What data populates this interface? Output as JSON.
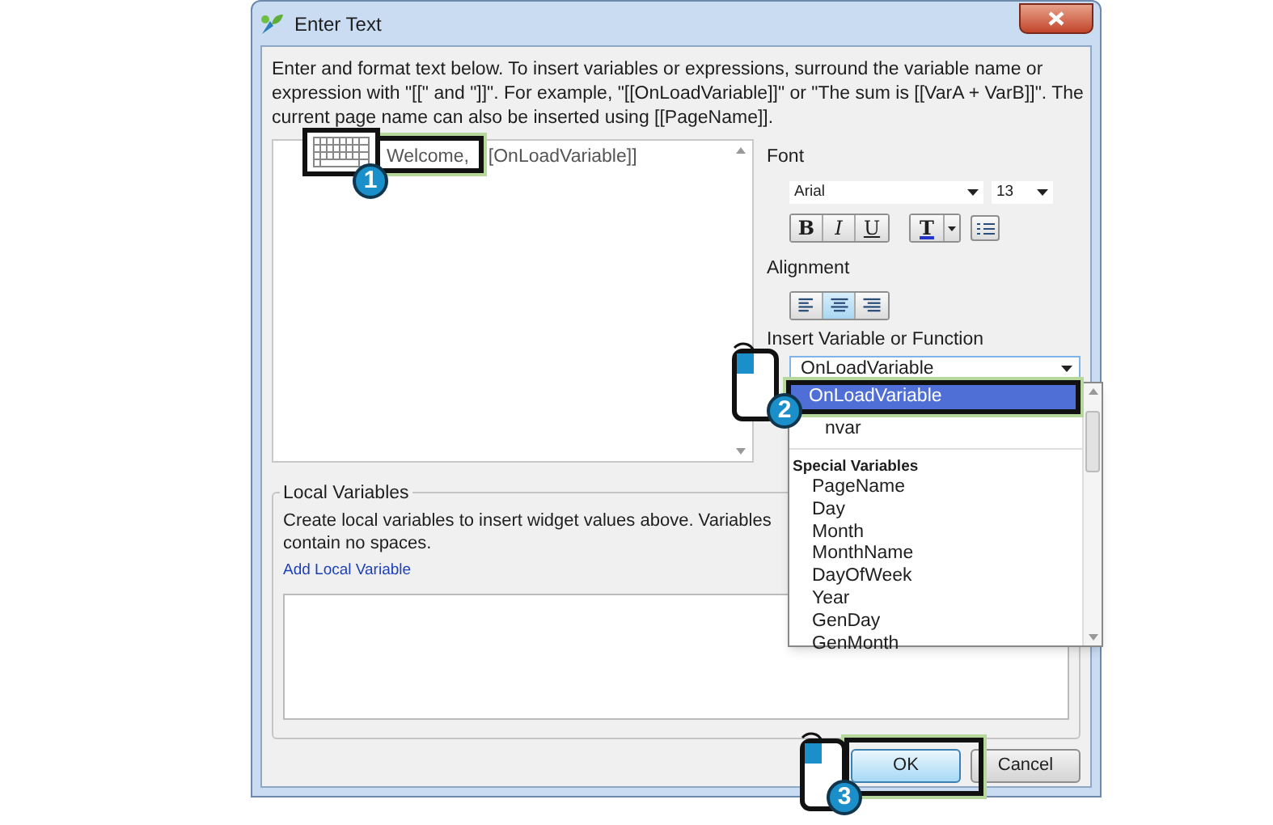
{
  "window": {
    "title": "Enter Text"
  },
  "intro": "Enter and format text below. To insert variables or expressions, surround the variable name or expression with \"[[\" and \"]]\". For example, \"[[OnLoadVariable]]\" or \"The sum is [[VarA + VarB]]\". The current page name can also be inserted using [[PageName]].",
  "editor": {
    "segments": [
      "Welcome,",
      "[OnLoadVariable]]"
    ]
  },
  "font": {
    "label": "Font",
    "family": "Arial",
    "size": "13"
  },
  "format_buttons": [
    {
      "label": "B",
      "kind": "bold"
    },
    {
      "label": "I",
      "kind": "italic"
    },
    {
      "label": "U",
      "kind": "underline"
    }
  ],
  "color_button": {
    "label": "T"
  },
  "alignment": {
    "label": "Alignment",
    "options": [
      {
        "kind": "left",
        "selected": false
      },
      {
        "kind": "center",
        "selected": true
      },
      {
        "kind": "right",
        "selected": false
      }
    ]
  },
  "insert": {
    "label": "Insert Variable or Function",
    "value": "OnLoadVariable",
    "items": [
      {
        "label": "OnLoadVariable",
        "selected": true
      },
      {
        "label": "nvar",
        "selected": false
      }
    ],
    "groups": [
      {
        "heading": "Special Variables",
        "items": [
          "PageName",
          "Day",
          "Month",
          "MonthName",
          "DayOfWeek",
          "Year",
          "GenDay",
          "GenMonth"
        ]
      }
    ]
  },
  "local_variables": {
    "title": "Local Variables",
    "description_lines": [
      "Create local variables to insert widget values above. Variables",
      "contain no spaces."
    ],
    "link": "Add Local Variable"
  },
  "buttons": [
    {
      "label": "OK",
      "kind": "primary"
    },
    {
      "label": "Cancel",
      "kind": "default"
    }
  ],
  "callouts": [
    {
      "number": "1",
      "kind": "keyboard"
    },
    {
      "number": "2",
      "kind": "mouse"
    },
    {
      "number": "3",
      "kind": "mouse"
    }
  ]
}
